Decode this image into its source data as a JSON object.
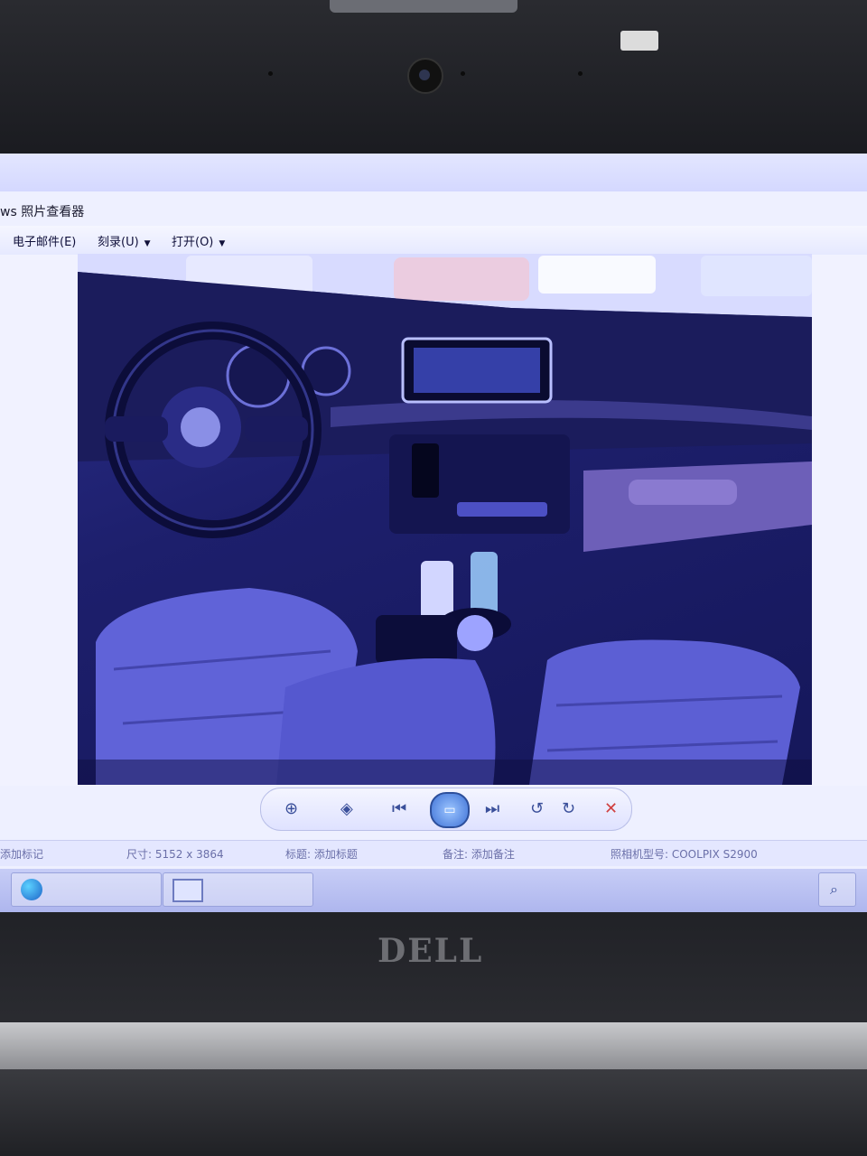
{
  "window": {
    "title": "ws 照片查看器"
  },
  "menu": [
    {
      "label": "电子邮件(E)",
      "has_dropdown": false
    },
    {
      "label": "刻录(U)",
      "has_dropdown": true
    },
    {
      "label": "打开(O)",
      "has_dropdown": true
    }
  ],
  "controls": {
    "zoom_icon": "magnifier-icon",
    "fit_icon": "actual-size-icon",
    "prev_icon": "previous-icon",
    "slideshow_icon": "slideshow-icon",
    "next_icon": "next-icon",
    "rotate_left_icon": "rotate-ccw-icon",
    "rotate_right_icon": "rotate-cw-icon",
    "delete_icon": "delete-icon"
  },
  "status": {
    "tags": "添加标记",
    "dimensions": "尺寸: 5152 x 3864",
    "title": "标题: 添加标题",
    "comment": "备注: 添加备注",
    "camera": "照相机型号: COOLPIX S2900"
  },
  "brand": {
    "logo": "DELL"
  },
  "colors": {
    "screen_tint": "#eef0ff",
    "photo_tint": "#2b2e8a",
    "delete": "#d04040"
  }
}
